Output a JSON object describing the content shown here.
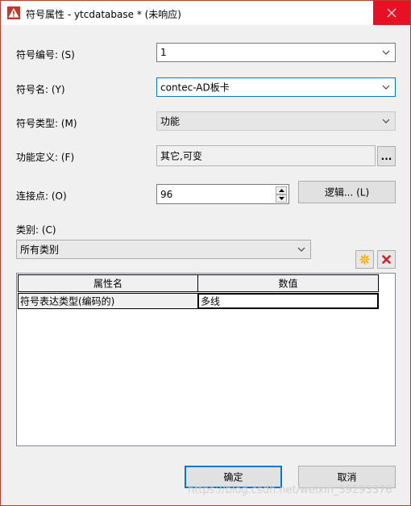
{
  "window": {
    "title": "符号属性 - ytcdatabase * (未响应)",
    "app_icon": "warning-triangle-icon",
    "close_icon": "close-icon",
    "close_color": "#e81123"
  },
  "form": {
    "symbol_number": {
      "label": "符号编号: (S)",
      "value": "1"
    },
    "symbol_name": {
      "label": "符号名: (Y)",
      "value": "contec-AD板卡"
    },
    "symbol_type": {
      "label": "符号类型: (M)",
      "value": "功能"
    },
    "function_definition": {
      "label": "功能定义: (F)",
      "value": "其它,可变",
      "browse_label": "..."
    },
    "connection_points": {
      "label": "连接点: (O)",
      "value": "96"
    },
    "logic_button": "逻辑... (L)",
    "category": {
      "label": "类别: (C)",
      "value": "所有类别"
    }
  },
  "property_grid": {
    "columns": [
      "属性名",
      "数值"
    ],
    "rows": [
      {
        "name": "符号表达类型(编码的)",
        "value": "多线"
      }
    ],
    "new_icon": "new-star-icon",
    "delete_icon": "delete-x-icon"
  },
  "footer": {
    "ok_label": "确定",
    "cancel_label": "取消"
  },
  "accent_color": "#0078d7",
  "watermark": "https://blog.csdn.net/weixin_39293376"
}
